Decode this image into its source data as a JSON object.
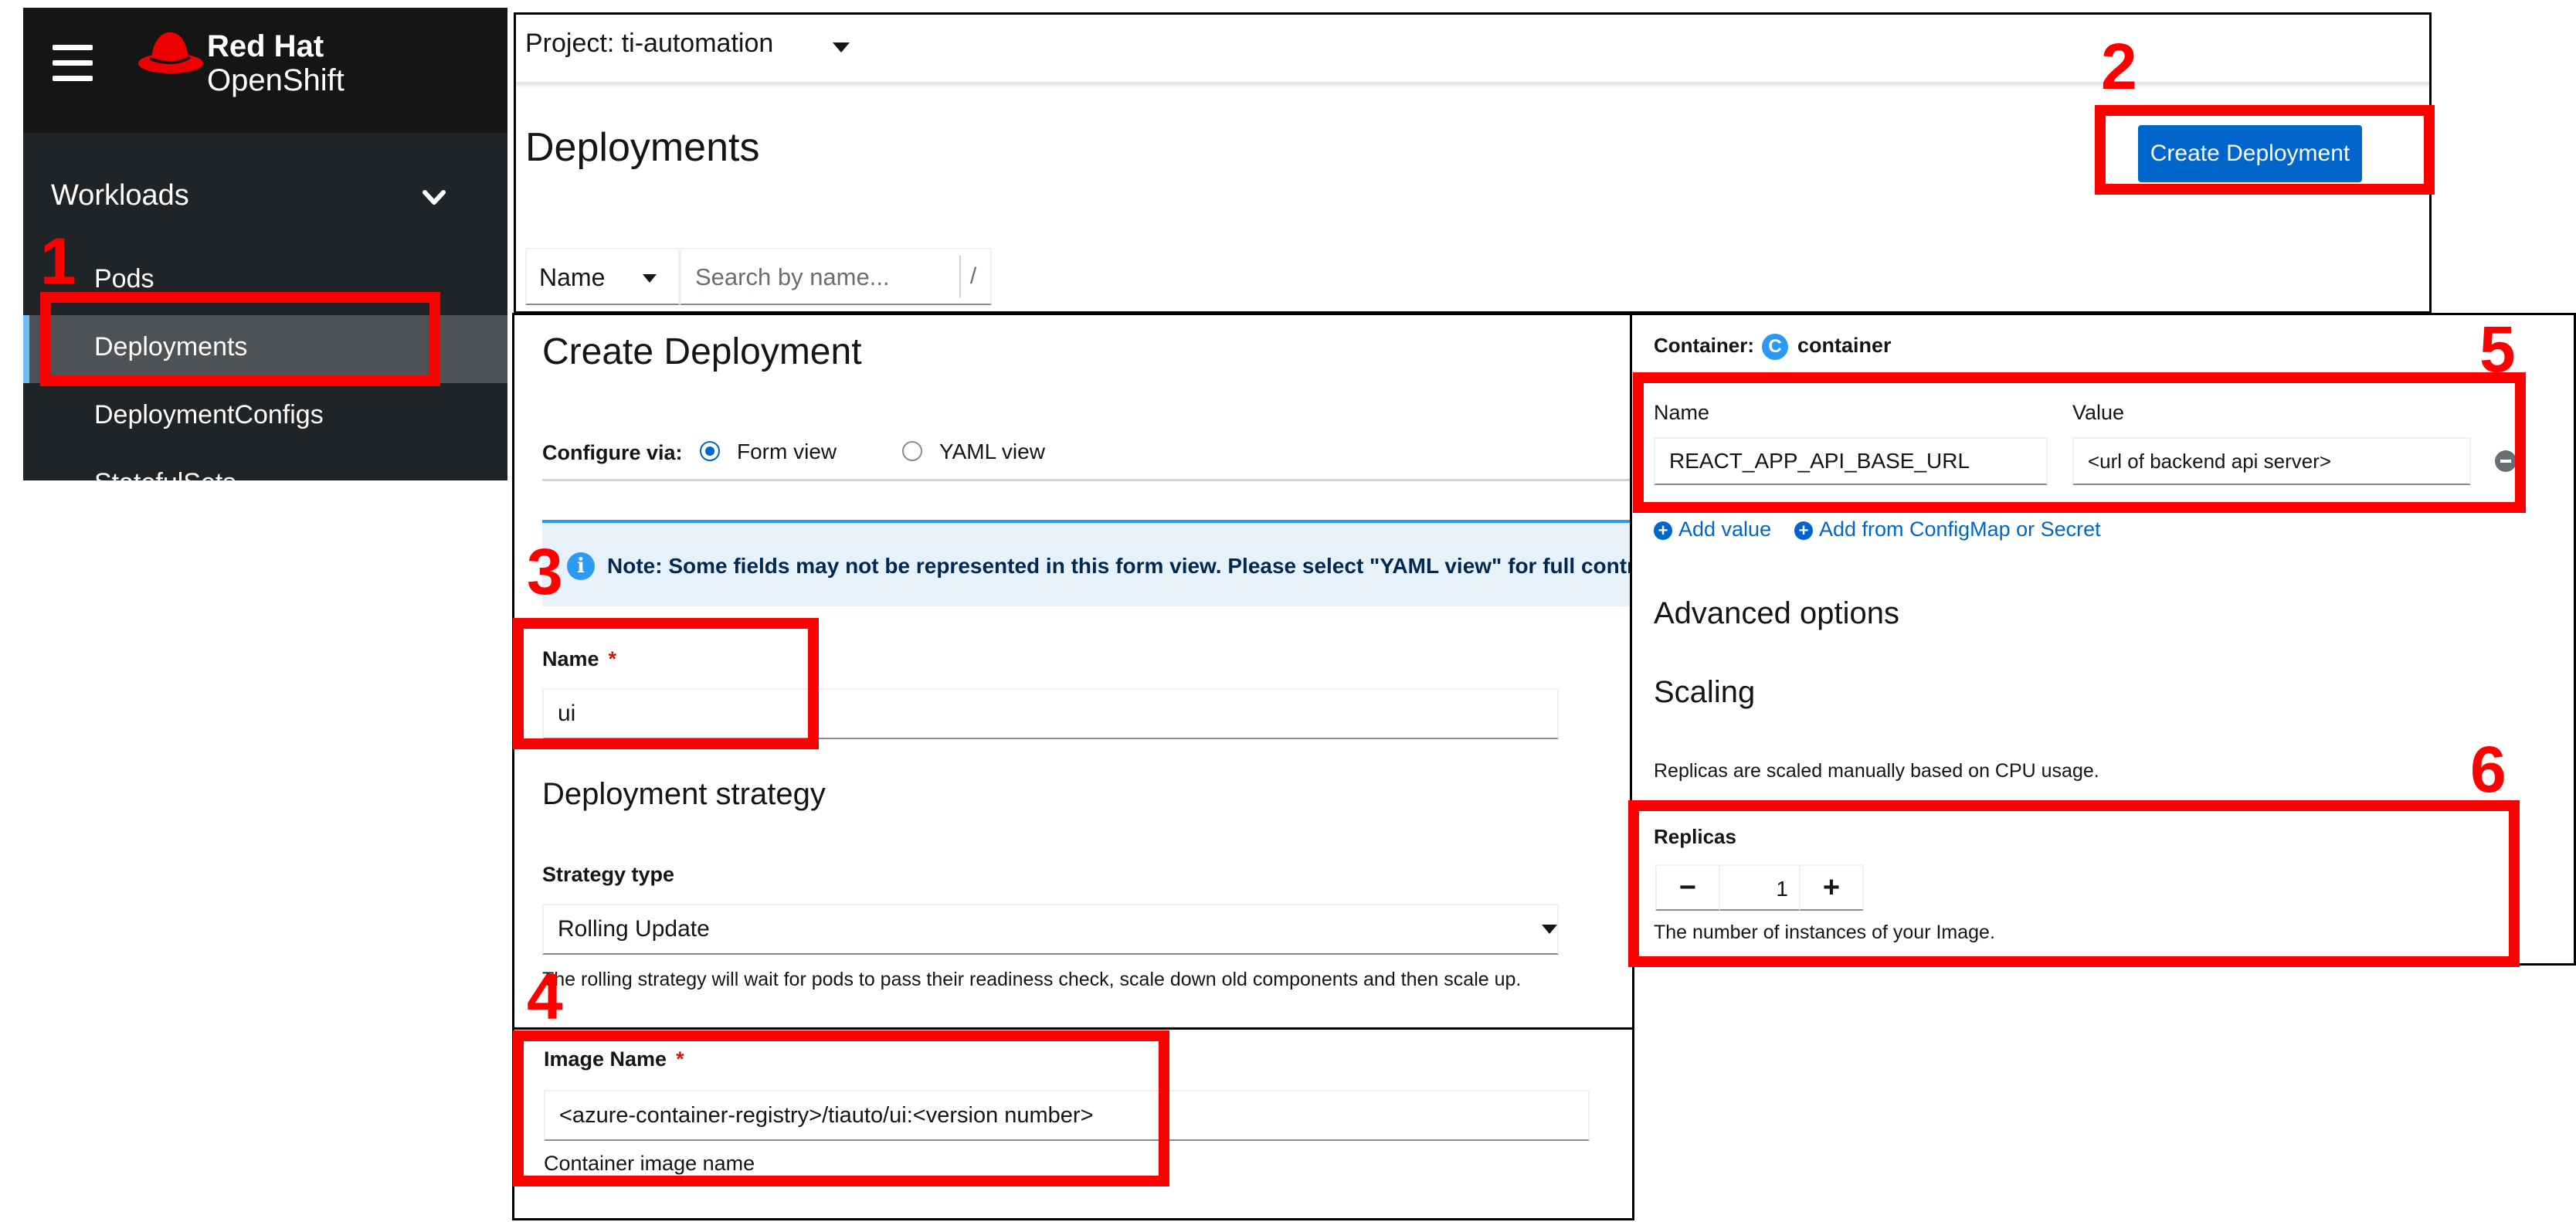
{
  "brand": {
    "line1": "Red Hat",
    "line2": "OpenShift",
    "hat_color": "#ee0000"
  },
  "sidebar": {
    "section": "Workloads",
    "items": [
      {
        "label": "Pods",
        "active": false
      },
      {
        "label": "Deployments",
        "active": true
      },
      {
        "label": "DeploymentConfigs",
        "active": false
      },
      {
        "label": "StatefulSets",
        "active": false
      }
    ]
  },
  "list_page": {
    "project_label": "Project: ti-automation",
    "title": "Deployments",
    "create_button": "Create Deployment",
    "filter_label": "Name",
    "search_placeholder": "Search by name...",
    "search_shortcut": "/"
  },
  "form": {
    "title": "Create Deployment",
    "configure_label": "Configure via:",
    "form_view_label": "Form view",
    "yaml_view_label": "YAML view",
    "selected_view": "Form view",
    "note": "Note: Some fields may not be represented in this form view. Please select \"YAML view\" for full control.",
    "name_label": "Name",
    "name_value": "ui",
    "strategy_section": "Deployment strategy",
    "strategy_type_label": "Strategy type",
    "strategy_value": "Rolling Update",
    "strategy_helper": "The rolling strategy will wait for pods to pass their readiness check, scale down old components and then scale up.",
    "image_label": "Image Name",
    "image_value": "<azure-container-registry>/tiauto/ui:<version number>",
    "image_helper": "Container image name"
  },
  "container_panel": {
    "container_label": "Container:",
    "container_badge": "C",
    "container_name": "container",
    "env_name_header": "Name",
    "env_value_header": "Value",
    "env_name": "REACT_APP_API_BASE_URL",
    "env_value": "<url of backend api server>",
    "add_value": "Add value",
    "add_from_configmap": "Add from ConfigMap or Secret",
    "advanced_title": "Advanced options",
    "scaling_title": "Scaling",
    "scaling_helper": "Replicas are scaled manually based on CPU usage.",
    "replicas_label": "Replicas",
    "replicas_value": "1",
    "minus_glyph": "−",
    "plus_glyph": "+",
    "replicas_helper": "The number of instances of your Image."
  },
  "annotations": [
    "1",
    "2",
    "3",
    "4",
    "5",
    "6"
  ],
  "colors": {
    "primary": "#0066cc",
    "highlight": "#ff0000",
    "sidebar_bg": "#212427",
    "masthead_bg": "#151515"
  }
}
